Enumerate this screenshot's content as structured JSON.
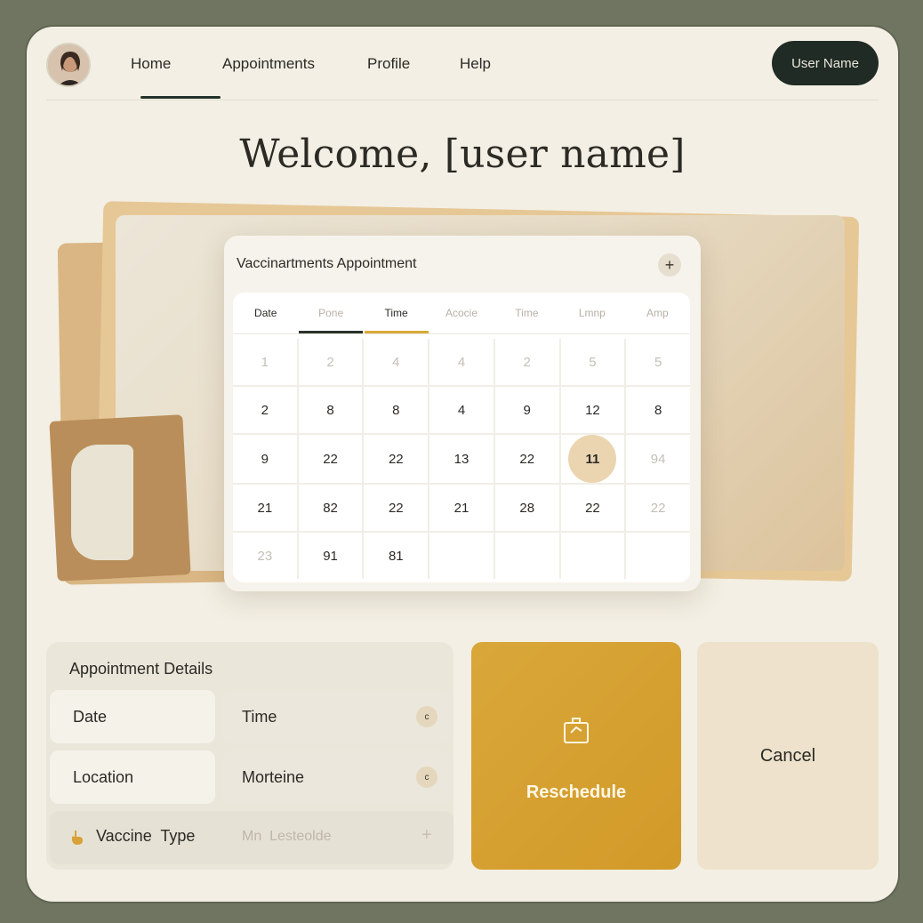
{
  "nav": {
    "links": [
      "Home",
      "Appointments",
      "Profile",
      "Help"
    ],
    "active_index": 0,
    "user_button": "User Name"
  },
  "welcome_text": "Welcome, [user name]",
  "calendar": {
    "title": "Vaccinartments Appointment",
    "add_label": "+",
    "headers": [
      "Date",
      "Pone",
      "Time",
      "Acocie",
      "Time",
      "Lmnp",
      "Amp"
    ],
    "rows": [
      [
        "1",
        "2",
        "4",
        "4",
        "2",
        "5",
        "5"
      ],
      [
        "2",
        "8",
        "8",
        "4",
        "9",
        "12",
        "8"
      ],
      [
        "9",
        "22",
        "22",
        "13",
        "22",
        "11",
        "94"
      ],
      [
        "21",
        "82",
        "22",
        "21",
        "28",
        "22",
        "22"
      ],
      [
        "23",
        "91",
        "81",
        "",
        "",
        "",
        ""
      ]
    ],
    "selected_value": "11"
  },
  "details": {
    "title": "Appointment Details",
    "date_label": "Date",
    "time_label": "Time",
    "location_label": "Location",
    "location_value": "Morteine",
    "vaccine_label": "Vaccine  Type",
    "vaccine_placeholder": "Mn  Lesteolde",
    "vaccine_add": "+",
    "knob_symbol": "c"
  },
  "actions": {
    "reschedule_label": "Reschedule",
    "cancel_label": "Cancel"
  },
  "colors": {
    "frame_bg": "#6f7561",
    "page_bg": "#f3efe4",
    "accent_gold": "#d6a232",
    "dark_button": "#1f2b24"
  }
}
